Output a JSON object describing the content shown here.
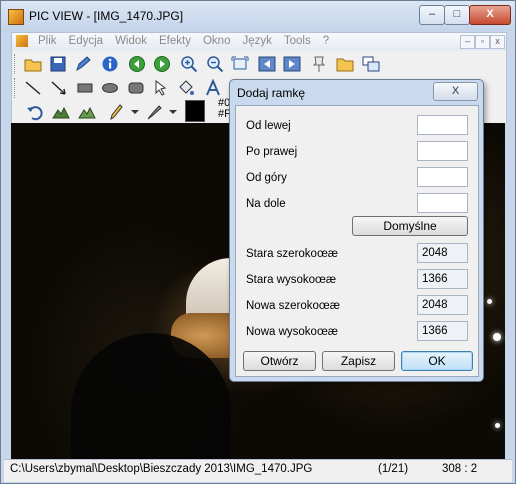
{
  "window": {
    "title": "PIC VIEW  - [IMG_1470.JPG]",
    "controls": {
      "minimize": "–",
      "maximize": "□",
      "close": "X"
    }
  },
  "menu": {
    "items": [
      "Plik",
      "Edycja",
      "Widok",
      "Efekty",
      "Okno",
      "Język",
      "Tools",
      "?"
    ],
    "mdi_controls": {
      "minimize": "–",
      "restore": "▫",
      "close": "x"
    }
  },
  "toolbar": {
    "color_codes": [
      "#0",
      "#F"
    ]
  },
  "statusbar": {
    "path": "C:\\Users\\zbymal\\Desktop\\Bieszczady 2013\\IMG_1470.JPG",
    "count": "(1/21)",
    "coords": "308 : 2"
  },
  "dialog": {
    "title": "Dodaj ramkę",
    "close_label": "X",
    "fields": [
      {
        "label": "Od lewej",
        "value": ""
      },
      {
        "label": "Po prawej",
        "value": ""
      },
      {
        "label": "Od góry",
        "value": ""
      },
      {
        "label": "Na dole",
        "value": ""
      }
    ],
    "default_button": "Domyślne",
    "info": [
      {
        "label": "Stara szerokoœæ",
        "value": "2048"
      },
      {
        "label": "Stara wysokoœæ",
        "value": "1366"
      },
      {
        "label": "Nowa szerokoœæ",
        "value": "2048"
      },
      {
        "label": "Nowa wysokoœæ",
        "value": "1366"
      }
    ],
    "buttons": {
      "open": "Otwórz",
      "save": "Zapisz",
      "ok": "OK"
    }
  }
}
